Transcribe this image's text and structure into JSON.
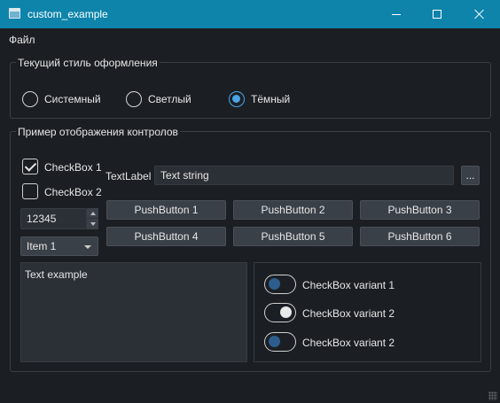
{
  "window": {
    "title": "custom_example"
  },
  "menu": {
    "file": "Файл"
  },
  "style_group": {
    "title": "Текущий стиль оформления",
    "options": [
      {
        "label": "Системный",
        "selected": false
      },
      {
        "label": "Светлый",
        "selected": false
      },
      {
        "label": "Тёмный",
        "selected": true
      }
    ]
  },
  "controls_group": {
    "title": "Пример отображения контролов",
    "checkbox1": {
      "label": "CheckBox 1",
      "checked": true
    },
    "checkbox2": {
      "label": "CheckBox 2",
      "checked": false
    },
    "text_label": "TextLabel",
    "line_edit_value": "Text string",
    "browse_label": "...",
    "spinbox_value": "12345",
    "combo_value": "Item 1",
    "push_buttons": [
      "PushButton 1",
      "PushButton 2",
      "PushButton 3",
      "PushButton 4",
      "PushButton 5",
      "PushButton 6"
    ],
    "text_edit_value": "Text example",
    "toggles": [
      {
        "label": "CheckBox variant 1",
        "checked": false
      },
      {
        "label": "CheckBox variant 2",
        "checked": true
      },
      {
        "label": "CheckBox variant 2",
        "checked": false
      }
    ]
  },
  "colors": {
    "titlebar": "#0e84ab",
    "background": "#1b1f24",
    "accent": "#4aa5e6",
    "toggle_knob_off": "#2d5d8c"
  }
}
